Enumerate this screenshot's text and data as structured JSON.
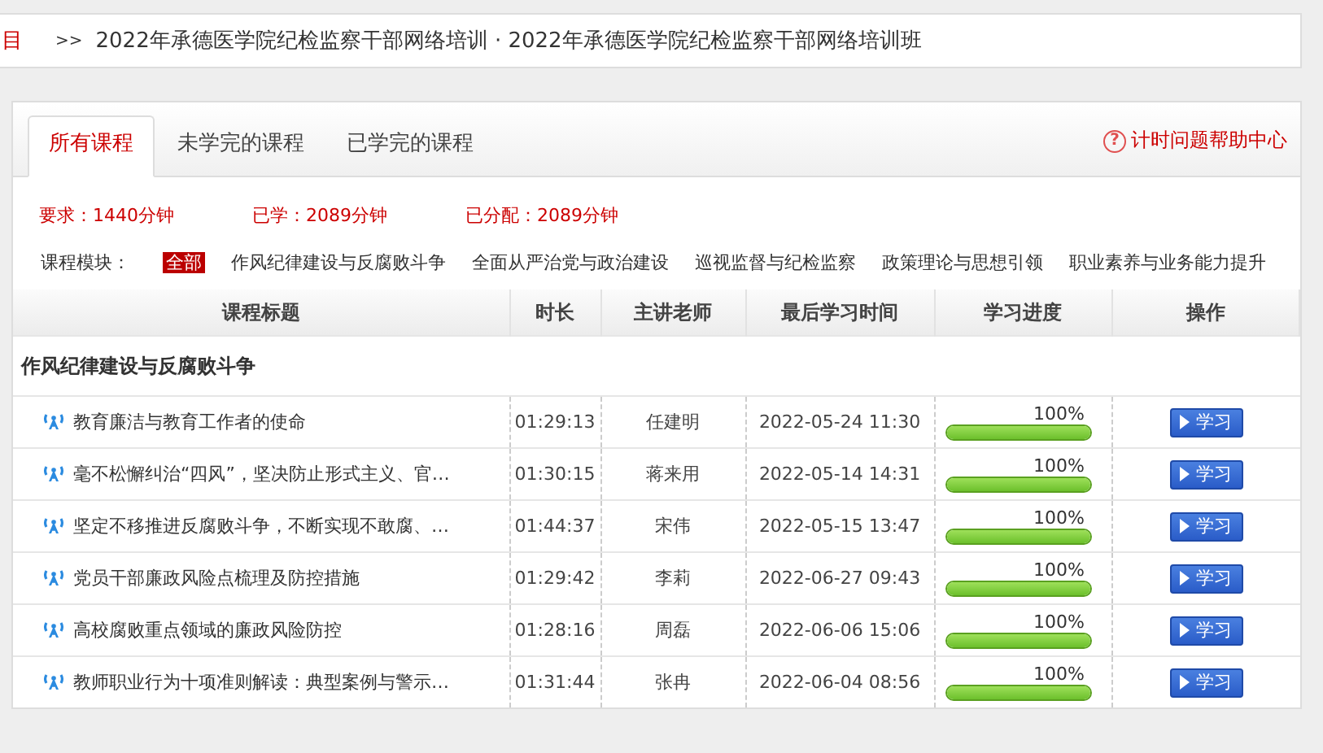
{
  "breadcrumb": {
    "cut_label": "目",
    "separator": ">>",
    "path": "2022年承德医学院纪检监察干部网络培训 · 2022年承德医学院纪检监察干部网络培训班"
  },
  "tabs": [
    {
      "label": "所有课程",
      "selected": true
    },
    {
      "label": "未学完的课程",
      "selected": false
    },
    {
      "label": "已学完的课程",
      "selected": false
    }
  ],
  "help_link": {
    "icon": "?",
    "label": "计时问题帮助中心"
  },
  "stats": [
    "要求：1440分钟",
    "已学：2089分钟",
    "已分配：2089分钟"
  ],
  "modules": {
    "label": "课程模块：",
    "items": [
      {
        "label": "全部",
        "selected": true
      },
      {
        "label": "作风纪律建设与反腐败斗争",
        "selected": false
      },
      {
        "label": "全面从严治党与政治建设",
        "selected": false
      },
      {
        "label": "巡视监督与纪检监察",
        "selected": false
      },
      {
        "label": "政策理论与思想引领",
        "selected": false
      },
      {
        "label": "职业素养与业务能力提升",
        "selected": false
      }
    ]
  },
  "table": {
    "columns": [
      "课程标题",
      "时长",
      "主讲老师",
      "最后学习时间",
      "学习进度",
      "操作"
    ],
    "group": "作风纪律建设与反腐败斗争",
    "rows": [
      {
        "title": "教育廉洁与教育工作者的使命",
        "duration": "01:29:13",
        "teacher": "任建明",
        "last": "2022-05-24 11:30",
        "percent": "100%",
        "level": 1,
        "action": "学习"
      },
      {
        "title": "毫不松懈纠治“四风”，坚决防止形式主义、官…",
        "duration": "01:30:15",
        "teacher": "蒋来用",
        "last": "2022-05-14 14:31",
        "percent": "100%",
        "level": 1,
        "action": "学习"
      },
      {
        "title": "坚定不移推进反腐败斗争，不断实现不敢腐、…",
        "duration": "01:44:37",
        "teacher": "宋伟",
        "last": "2022-05-15 13:47",
        "percent": "100%",
        "level": 1,
        "action": "学习"
      },
      {
        "title": "党员干部廉政风险点梳理及防控措施",
        "duration": "01:29:42",
        "teacher": "李莉",
        "last": "2022-06-27 09:43",
        "percent": "100%",
        "level": 1,
        "action": "学习"
      },
      {
        "title": "高校腐败重点领域的廉政风险防控",
        "duration": "01:28:16",
        "teacher": "周磊",
        "last": "2022-06-06 15:06",
        "percent": "100%",
        "level": 1,
        "action": "学习"
      },
      {
        "title": "教师职业行为十项准则解读：典型案例与警示…",
        "duration": "01:31:44",
        "teacher": "张冉",
        "last": "2022-06-04 08:56",
        "percent": "100%",
        "level": 1,
        "action": "学习"
      }
    ]
  }
}
